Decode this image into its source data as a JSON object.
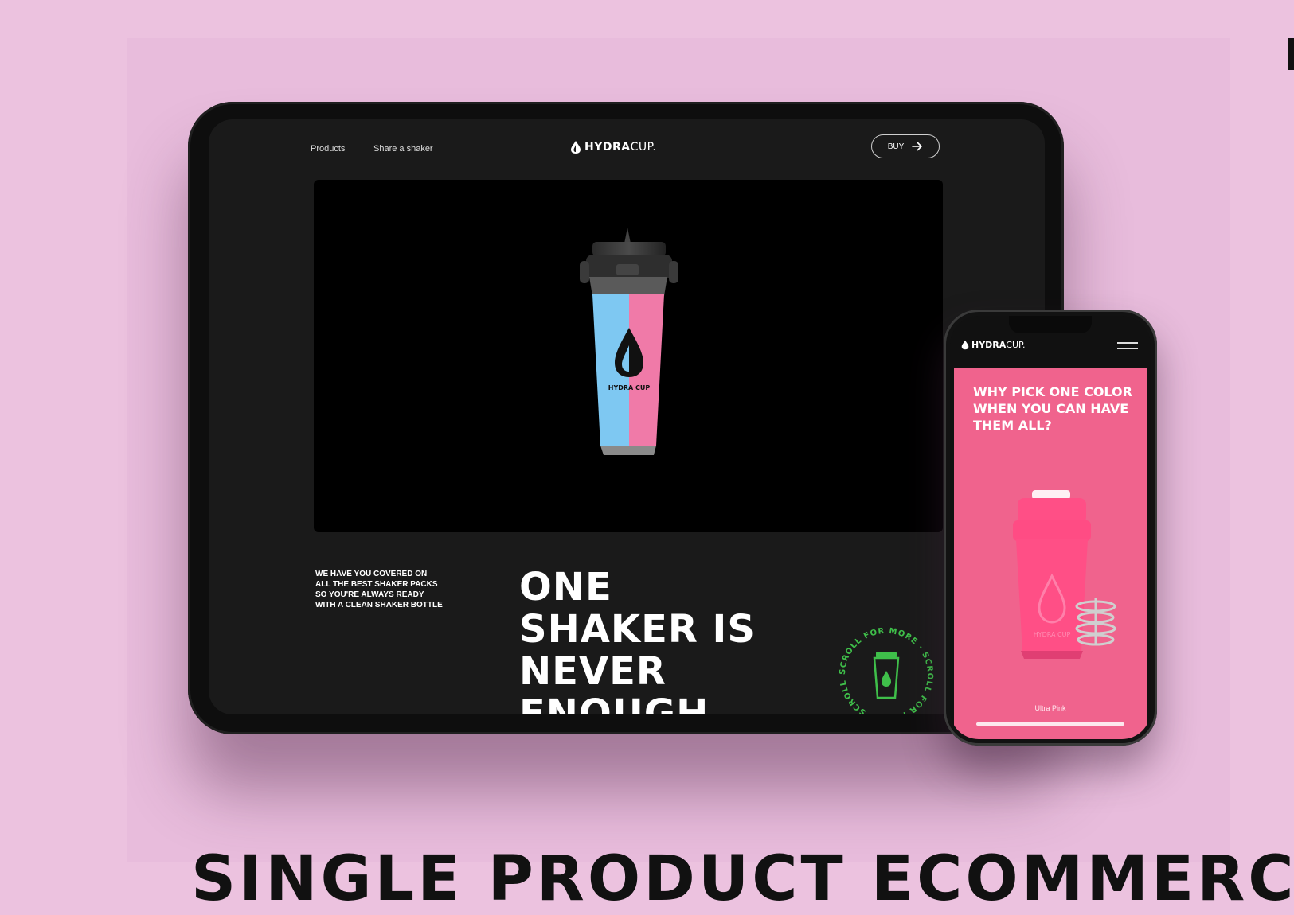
{
  "tablet": {
    "nav": {
      "products": "Products",
      "share": "Share a shaker"
    },
    "logo": {
      "strong": "HYDRA",
      "light": "CUP."
    },
    "buy_label": "BUY",
    "bottle_brand": "HYDRA CUP",
    "blurb": "WE HAVE YOU COVERED ON ALL THE BEST SHAKER PACKS SO YOU'RE ALWAYS READY WITH A CLEAN SHAKER BOTTLE",
    "headline": {
      "line1": "ONE",
      "line2": "SHAKER IS",
      "line3": "NEVER",
      "line4": "ENOUGH"
    },
    "scroll_badge": "SCROLL FOR MORE · SCROLL FOR MORE · SCROLL FOR MORE · "
  },
  "phone": {
    "logo": {
      "strong": "HYDRA",
      "light": "CUP."
    },
    "headline": "WHY PICK ONE COLOR WHEN YOU CAN HAVE THEM ALL?",
    "shaker_brand": "HYDRA CUP",
    "caption": "Ultra Pink"
  },
  "page": {
    "title": "SINGLE PRODUCT ECOMMERCE"
  },
  "colors": {
    "background": "#ecc2df",
    "device": "#0e0e0e",
    "screen": "#1a1a1a",
    "phone_accent": "#f0638d",
    "badge_green": "#3fbf4a",
    "bottle_blue": "#7ec8f2",
    "bottle_pink": "#f07aa8"
  },
  "icons": [
    "drop-logo-icon",
    "arrow-right-icon",
    "hamburger-menu-icon",
    "shaker-icon"
  ]
}
